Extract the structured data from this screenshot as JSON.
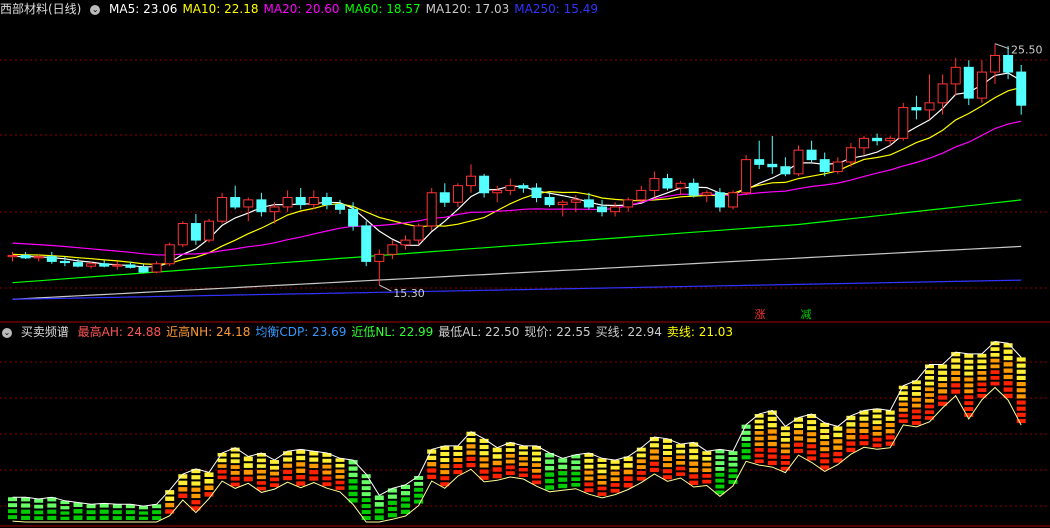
{
  "top_panel": {
    "title": "西部材料(日线)",
    "ma_labels": [
      {
        "label": "MA5: 23.06",
        "color": "#ffffff"
      },
      {
        "label": "MA10: 22.18",
        "color": "#ffff00"
      },
      {
        "label": "MA20: 20.60",
        "color": "#ff00ff"
      },
      {
        "label": "MA60: 18.57",
        "color": "#00ff00"
      },
      {
        "label": "MA120: 17.03",
        "color": "#c8c8c8"
      },
      {
        "label": "MA250: 15.49",
        "color": "#3333ff"
      }
    ],
    "high_marker": "25.50",
    "low_marker": "15.30",
    "bottom_tags": [
      {
        "label": "涨",
        "color": "#ff3333"
      },
      {
        "label": "减",
        "color": "#00cc00"
      }
    ]
  },
  "bottom_panel": {
    "title": "买卖频谱",
    "legend": [
      {
        "label": "最高AH: 24.88",
        "color": "#ff5555"
      },
      {
        "label": "近高NH: 24.18",
        "color": "#ff9933"
      },
      {
        "label": "均衡CDP: 23.69",
        "color": "#3399ff"
      },
      {
        "label": "近低NL: 22.99",
        "color": "#33ff33"
      },
      {
        "label": "最低AL: 22.50",
        "color": "#cccccc"
      },
      {
        "label": "现价: 22.55",
        "color": "#cccccc"
      },
      {
        "label": "买线: 22.94",
        "color": "#cccccc"
      },
      {
        "label": "卖线: 21.03",
        "color": "#ffff00"
      }
    ]
  },
  "colors": {
    "up": "#ff3333",
    "down": "#54ffff",
    "ma5": "#ffffff",
    "ma10": "#ffff00",
    "ma20": "#ff00ff",
    "ma60": "#00ff00",
    "ma120": "#c8c8c8",
    "ma250": "#3333ff",
    "grid": "#8b0000"
  },
  "chart_data": {
    "type": "candlestick",
    "ohlc": [
      [
        16.5,
        16.7,
        16.3,
        16.55
      ],
      [
        16.55,
        16.7,
        16.4,
        16.45
      ],
      [
        16.45,
        16.6,
        16.3,
        16.5
      ],
      [
        16.5,
        16.7,
        16.2,
        16.3
      ],
      [
        16.3,
        16.5,
        16.1,
        16.25
      ],
      [
        16.25,
        16.4,
        16.05,
        16.1
      ],
      [
        16.1,
        16.3,
        16.0,
        16.2
      ],
      [
        16.2,
        16.35,
        16.05,
        16.1
      ],
      [
        16.1,
        16.3,
        15.95,
        16.15
      ],
      [
        16.15,
        16.3,
        16.0,
        16.05
      ],
      [
        16.05,
        16.2,
        15.8,
        15.85
      ],
      [
        15.85,
        16.3,
        15.8,
        16.2
      ],
      [
        16.2,
        17.1,
        16.1,
        17.0
      ],
      [
        17.0,
        18.0,
        16.9,
        17.9
      ],
      [
        17.9,
        18.3,
        17.0,
        17.2
      ],
      [
        17.2,
        18.1,
        17.1,
        18.0
      ],
      [
        18.0,
        19.2,
        17.9,
        19.0
      ],
      [
        19.0,
        19.5,
        18.5,
        18.6
      ],
      [
        18.6,
        19.0,
        18.0,
        18.9
      ],
      [
        18.9,
        19.2,
        18.2,
        18.4
      ],
      [
        18.4,
        18.8,
        17.9,
        18.6
      ],
      [
        18.6,
        19.3,
        18.4,
        19.0
      ],
      [
        19.0,
        19.4,
        18.5,
        18.7
      ],
      [
        18.7,
        19.3,
        18.5,
        19.0
      ],
      [
        19.0,
        19.2,
        18.5,
        18.7
      ],
      [
        18.7,
        18.9,
        18.3,
        18.5
      ],
      [
        18.5,
        18.8,
        17.6,
        17.8
      ],
      [
        17.8,
        18.0,
        16.1,
        16.3
      ],
      [
        16.3,
        16.8,
        15.3,
        16.6
      ],
      [
        16.6,
        17.2,
        16.4,
        17.0
      ],
      [
        17.0,
        17.4,
        16.8,
        17.2
      ],
      [
        17.2,
        17.9,
        17.0,
        17.8
      ],
      [
        17.8,
        19.4,
        17.6,
        19.2
      ],
      [
        19.2,
        19.6,
        18.6,
        18.8
      ],
      [
        18.8,
        19.6,
        18.6,
        19.5
      ],
      [
        19.5,
        20.4,
        19.2,
        19.9
      ],
      [
        19.9,
        20.0,
        19.0,
        19.2
      ],
      [
        19.2,
        19.5,
        18.8,
        19.3
      ],
      [
        19.3,
        19.8,
        19.1,
        19.5
      ],
      [
        19.5,
        19.6,
        19.2,
        19.4
      ],
      [
        19.4,
        19.6,
        18.8,
        19.0
      ],
      [
        19.0,
        19.2,
        18.6,
        18.7
      ],
      [
        18.7,
        18.9,
        18.2,
        18.8
      ],
      [
        18.8,
        19.1,
        18.4,
        18.9
      ],
      [
        18.9,
        19.2,
        18.5,
        18.6
      ],
      [
        18.6,
        18.9,
        18.2,
        18.4
      ],
      [
        18.4,
        18.8,
        18.2,
        18.6
      ],
      [
        18.6,
        19.0,
        18.4,
        18.9
      ],
      [
        18.9,
        19.5,
        18.8,
        19.3
      ],
      [
        19.3,
        20.1,
        19.0,
        19.8
      ],
      [
        19.8,
        20.0,
        19.3,
        19.4
      ],
      [
        19.4,
        19.7,
        19.1,
        19.6
      ],
      [
        19.6,
        19.8,
        19.0,
        19.1
      ],
      [
        19.1,
        19.3,
        18.8,
        19.2
      ],
      [
        19.2,
        19.4,
        18.4,
        18.6
      ],
      [
        18.6,
        19.3,
        18.5,
        19.2
      ],
      [
        19.2,
        20.8,
        19.1,
        20.6
      ],
      [
        20.6,
        21.4,
        20.2,
        20.4
      ],
      [
        20.4,
        21.6,
        20.0,
        20.3
      ],
      [
        20.3,
        20.7,
        19.9,
        20.0
      ],
      [
        20.0,
        21.2,
        19.9,
        21.0
      ],
      [
        21.0,
        21.4,
        20.5,
        20.6
      ],
      [
        20.6,
        20.9,
        19.9,
        20.1
      ],
      [
        20.1,
        20.7,
        20.0,
        20.5
      ],
      [
        20.5,
        21.3,
        20.3,
        21.1
      ],
      [
        21.1,
        21.6,
        20.8,
        21.5
      ],
      [
        21.5,
        21.7,
        21.2,
        21.4
      ],
      [
        21.4,
        21.6,
        21.2,
        21.5
      ],
      [
        21.5,
        23.0,
        21.4,
        22.8
      ],
      [
        22.8,
        23.3,
        22.3,
        22.7
      ],
      [
        22.7,
        24.2,
        22.3,
        23.0
      ],
      [
        23.0,
        24.2,
        22.5,
        23.8
      ],
      [
        23.8,
        24.9,
        23.3,
        24.5
      ],
      [
        24.5,
        24.8,
        22.9,
        23.2
      ],
      [
        23.2,
        24.8,
        23.0,
        24.3
      ],
      [
        24.3,
        25.5,
        23.8,
        25.0
      ],
      [
        25.0,
        25.4,
        24.0,
        24.3
      ],
      [
        24.3,
        24.6,
        22.5,
        22.9
      ]
    ],
    "ylim": [
      14.5,
      26.5
    ],
    "low_index": 28,
    "high_index": 75
  }
}
